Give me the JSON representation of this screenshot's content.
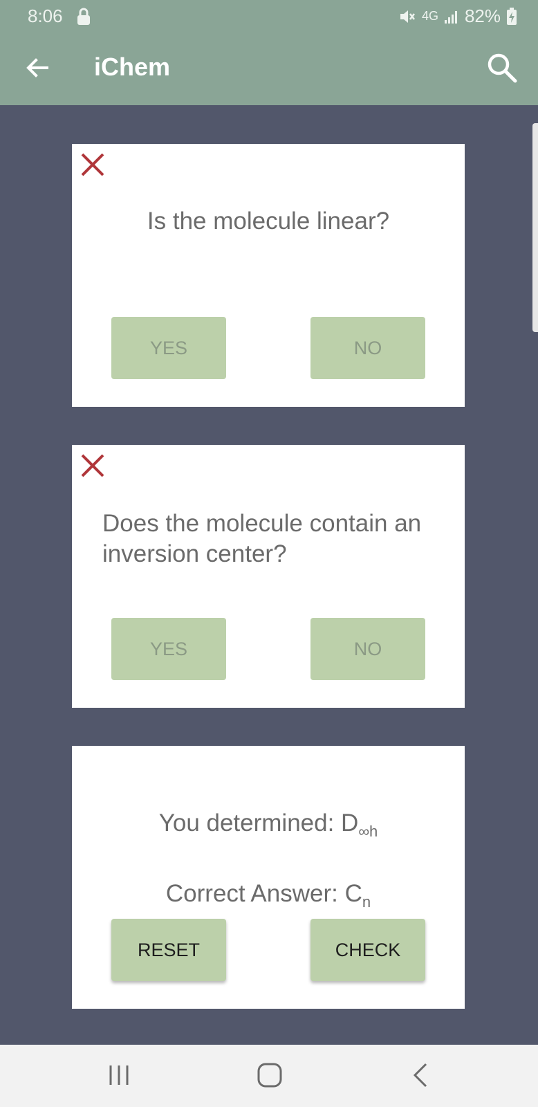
{
  "status_bar": {
    "time": "8:06",
    "network": "4G",
    "battery": "82%",
    "icons": [
      "lock-icon",
      "mute-icon",
      "signal-icon",
      "battery-charging-icon"
    ]
  },
  "app_bar": {
    "title": "iChem",
    "icons": [
      "back-arrow-icon",
      "search-icon"
    ]
  },
  "cards": [
    {
      "question": "Is the molecule linear?",
      "yes": "YES",
      "no": "NO",
      "status_icon": "close-icon"
    },
    {
      "question": "Does the molecule contain an inversion center?",
      "yes": "YES",
      "no": "NO",
      "status_icon": "close-icon"
    }
  ],
  "result": {
    "determined_label": "You determined: D",
    "determined_sub": "∞h",
    "correct_label": "Correct Answer: C",
    "correct_sub": "n",
    "reset": "RESET",
    "check": "CHECK"
  },
  "colors": {
    "app_bar": "#8aa596",
    "background": "#52576b",
    "button": "#bcd0aa",
    "error": "#b0363a"
  },
  "nav_bar": {
    "icons": [
      "recent-apps-icon",
      "home-icon",
      "back-icon"
    ]
  }
}
